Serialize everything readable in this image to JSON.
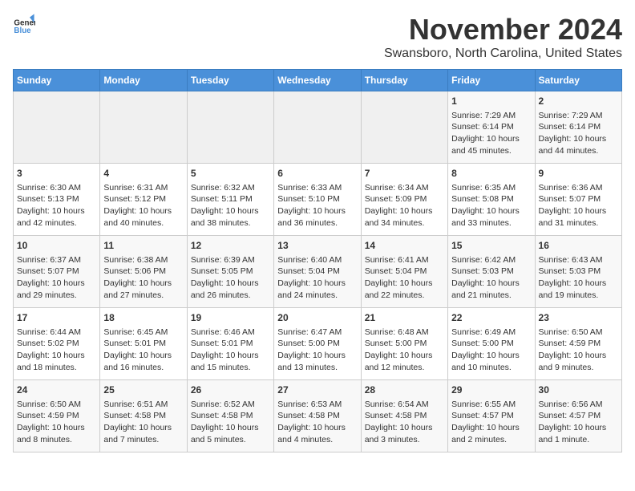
{
  "logo": {
    "line1": "General",
    "line2": "Blue"
  },
  "calendar": {
    "title": "November 2024",
    "subtitle": "Swansboro, North Carolina, United States",
    "days_of_week": [
      "Sunday",
      "Monday",
      "Tuesday",
      "Wednesday",
      "Thursday",
      "Friday",
      "Saturday"
    ],
    "weeks": [
      [
        {
          "day": "",
          "info": ""
        },
        {
          "day": "",
          "info": ""
        },
        {
          "day": "",
          "info": ""
        },
        {
          "day": "",
          "info": ""
        },
        {
          "day": "",
          "info": ""
        },
        {
          "day": "1",
          "info": "Sunrise: 7:29 AM\nSunset: 6:14 PM\nDaylight: 10 hours and 45 minutes."
        },
        {
          "day": "2",
          "info": "Sunrise: 7:29 AM\nSunset: 6:14 PM\nDaylight: 10 hours and 44 minutes."
        }
      ],
      [
        {
          "day": "3",
          "info": "Sunrise: 6:30 AM\nSunset: 5:13 PM\nDaylight: 10 hours and 42 minutes."
        },
        {
          "day": "4",
          "info": "Sunrise: 6:31 AM\nSunset: 5:12 PM\nDaylight: 10 hours and 40 minutes."
        },
        {
          "day": "5",
          "info": "Sunrise: 6:32 AM\nSunset: 5:11 PM\nDaylight: 10 hours and 38 minutes."
        },
        {
          "day": "6",
          "info": "Sunrise: 6:33 AM\nSunset: 5:10 PM\nDaylight: 10 hours and 36 minutes."
        },
        {
          "day": "7",
          "info": "Sunrise: 6:34 AM\nSunset: 5:09 PM\nDaylight: 10 hours and 34 minutes."
        },
        {
          "day": "8",
          "info": "Sunrise: 6:35 AM\nSunset: 5:08 PM\nDaylight: 10 hours and 33 minutes."
        },
        {
          "day": "9",
          "info": "Sunrise: 6:36 AM\nSunset: 5:07 PM\nDaylight: 10 hours and 31 minutes."
        }
      ],
      [
        {
          "day": "10",
          "info": "Sunrise: 6:37 AM\nSunset: 5:07 PM\nDaylight: 10 hours and 29 minutes."
        },
        {
          "day": "11",
          "info": "Sunrise: 6:38 AM\nSunset: 5:06 PM\nDaylight: 10 hours and 27 minutes."
        },
        {
          "day": "12",
          "info": "Sunrise: 6:39 AM\nSunset: 5:05 PM\nDaylight: 10 hours and 26 minutes."
        },
        {
          "day": "13",
          "info": "Sunrise: 6:40 AM\nSunset: 5:04 PM\nDaylight: 10 hours and 24 minutes."
        },
        {
          "day": "14",
          "info": "Sunrise: 6:41 AM\nSunset: 5:04 PM\nDaylight: 10 hours and 22 minutes."
        },
        {
          "day": "15",
          "info": "Sunrise: 6:42 AM\nSunset: 5:03 PM\nDaylight: 10 hours and 21 minutes."
        },
        {
          "day": "16",
          "info": "Sunrise: 6:43 AM\nSunset: 5:03 PM\nDaylight: 10 hours and 19 minutes."
        }
      ],
      [
        {
          "day": "17",
          "info": "Sunrise: 6:44 AM\nSunset: 5:02 PM\nDaylight: 10 hours and 18 minutes."
        },
        {
          "day": "18",
          "info": "Sunrise: 6:45 AM\nSunset: 5:01 PM\nDaylight: 10 hours and 16 minutes."
        },
        {
          "day": "19",
          "info": "Sunrise: 6:46 AM\nSunset: 5:01 PM\nDaylight: 10 hours and 15 minutes."
        },
        {
          "day": "20",
          "info": "Sunrise: 6:47 AM\nSunset: 5:00 PM\nDaylight: 10 hours and 13 minutes."
        },
        {
          "day": "21",
          "info": "Sunrise: 6:48 AM\nSunset: 5:00 PM\nDaylight: 10 hours and 12 minutes."
        },
        {
          "day": "22",
          "info": "Sunrise: 6:49 AM\nSunset: 5:00 PM\nDaylight: 10 hours and 10 minutes."
        },
        {
          "day": "23",
          "info": "Sunrise: 6:50 AM\nSunset: 4:59 PM\nDaylight: 10 hours and 9 minutes."
        }
      ],
      [
        {
          "day": "24",
          "info": "Sunrise: 6:50 AM\nSunset: 4:59 PM\nDaylight: 10 hours and 8 minutes."
        },
        {
          "day": "25",
          "info": "Sunrise: 6:51 AM\nSunset: 4:58 PM\nDaylight: 10 hours and 7 minutes."
        },
        {
          "day": "26",
          "info": "Sunrise: 6:52 AM\nSunset: 4:58 PM\nDaylight: 10 hours and 5 minutes."
        },
        {
          "day": "27",
          "info": "Sunrise: 6:53 AM\nSunset: 4:58 PM\nDaylight: 10 hours and 4 minutes."
        },
        {
          "day": "28",
          "info": "Sunrise: 6:54 AM\nSunset: 4:58 PM\nDaylight: 10 hours and 3 minutes."
        },
        {
          "day": "29",
          "info": "Sunrise: 6:55 AM\nSunset: 4:57 PM\nDaylight: 10 hours and 2 minutes."
        },
        {
          "day": "30",
          "info": "Sunrise: 6:56 AM\nSunset: 4:57 PM\nDaylight: 10 hours and 1 minute."
        }
      ]
    ]
  }
}
